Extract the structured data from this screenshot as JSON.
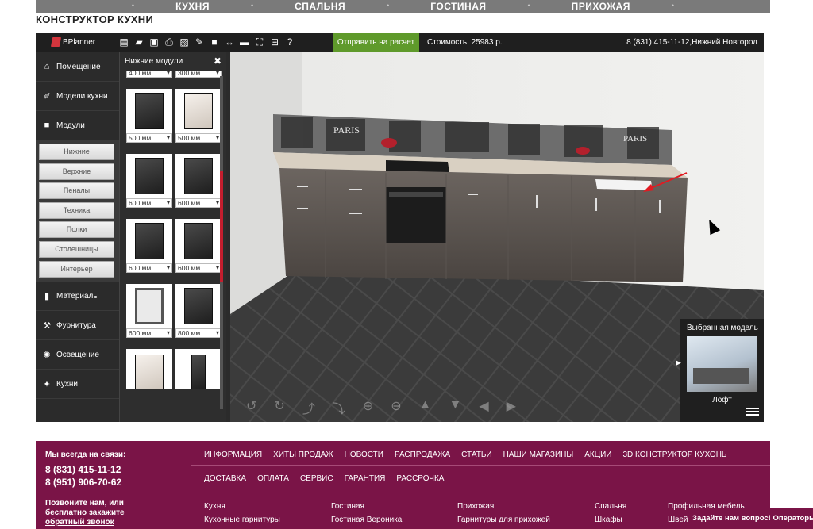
{
  "topnav": {
    "items": [
      "КУХНЯ",
      "СПАЛЬНЯ",
      "ГОСТИНАЯ",
      "ПРИХОЖАЯ"
    ]
  },
  "page_title": "КОНСТРУКТОР КУХНИ",
  "toolbar": {
    "logo_text": "BPlanner",
    "tools": [
      "new-file-icon",
      "open-folder-icon",
      "save-icon",
      "print-icon",
      "image-icon",
      "pencil-icon",
      "video-icon",
      "arrows-horizontal-icon",
      "comment-icon",
      "fullscreen-icon",
      "hide-panels-icon",
      "help-icon"
    ],
    "send_label": "Отправить на расчет",
    "cost_label": "Стоимость: 25983 р.",
    "phone_city": "8 (831) 415-11-12,Нижний Новгород"
  },
  "sidebar": {
    "items": [
      {
        "label": "Помещение",
        "icon": "home-icon"
      },
      {
        "label": "Модели кухни",
        "icon": "brush-icon"
      },
      {
        "label": "Модули",
        "icon": "cube-icon"
      },
      {
        "label": "Материалы",
        "icon": "paint-roller-icon"
      },
      {
        "label": "Фурнитура",
        "icon": "hammer-icon"
      },
      {
        "label": "Освещение",
        "icon": "lightbulb-icon"
      },
      {
        "label": "Кухни",
        "icon": "magic-wand-icon"
      }
    ],
    "sub_items": [
      "Нижние",
      "Верхние",
      "Пеналы",
      "Техника",
      "Полки",
      "Столешницы",
      "Интерьер"
    ]
  },
  "modules_panel": {
    "title": "Нижние модули",
    "top_partial": [
      "400 мм",
      "300 мм"
    ],
    "cells": [
      {
        "size": "500 мм",
        "style": "dark"
      },
      {
        "size": "500 мм",
        "style": "light"
      },
      {
        "size": "600 мм",
        "style": "dark"
      },
      {
        "size": "600 мм",
        "style": "dark"
      },
      {
        "size": "600 мм",
        "style": "dark"
      },
      {
        "size": "600 мм",
        "style": "dark"
      },
      {
        "size": "600 мм",
        "style": "empty"
      },
      {
        "size": "800 мм",
        "style": "dark"
      },
      {
        "size": "",
        "style": "light"
      },
      {
        "size": "",
        "style": "thin"
      }
    ]
  },
  "backsplash_text": [
    "PARIS",
    "PARIS"
  ],
  "view_controls": [
    "rotate-left-icon",
    "rotate-right-icon",
    "tilt-up-icon",
    "tilt-down-icon",
    "zoom-in-icon",
    "zoom-out-icon",
    "move-up-icon",
    "move-down-icon",
    "move-left-icon",
    "move-right-icon"
  ],
  "selected_model": {
    "title": "Выбранная модель",
    "name": "Лофт"
  },
  "footer": {
    "contact_head": "Мы всегда на связи:",
    "phone1": "8 (831) 415-11-12",
    "phone2": "8 (951) 906-70-62",
    "note_line1": "Позвоните нам, или",
    "note_line2": "бесплатно закажите",
    "note_link": "обратный звонок",
    "nav_row1": [
      "ИНФОРМАЦИЯ",
      "ХИТЫ ПРОДАЖ",
      "НОВОСТИ",
      "РАСПРОДАЖА",
      "СТАТЬИ",
      "НАШИ МАГАЗИНЫ",
      "АКЦИИ",
      "3D КОНСТРУКТОР КУХОНЬ"
    ],
    "nav_row2": [
      "ДОСТАВКА",
      "ОПЛАТА",
      "СЕРВИС",
      "ГАРАНТИЯ",
      "РАССРОЧКА"
    ],
    "col1": [
      "Кухня",
      "Кухонные гарнитуры"
    ],
    "col2": [
      "Гостиная",
      "Гостиная Вероника"
    ],
    "col3": [
      "Прихожая",
      "Гарнитуры для прихожей"
    ],
    "col4": [
      "Спальня",
      "Шкафы"
    ],
    "col5": [
      "Профильная мебель",
      "Швей"
    ]
  },
  "chat_tab": "Задайте нам вопрос! Операторы"
}
